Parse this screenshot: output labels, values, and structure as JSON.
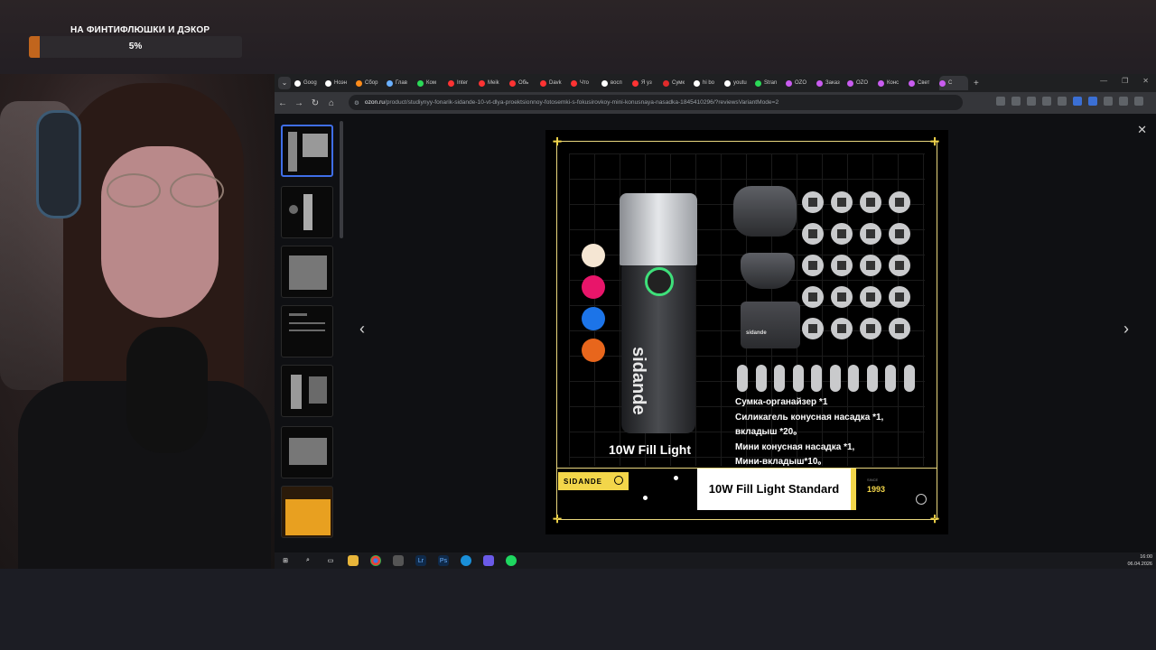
{
  "overlay": {
    "goal_title": "НА ФИНТИФЛЮШКИ И ДЭКОР",
    "goal_percent": "5%",
    "goal_progress": 0.05,
    "accent_color": "#c1651d"
  },
  "browser": {
    "tabs": [
      {
        "label": "Goog",
        "icon": "chrome-icon",
        "color": "#ffffff"
      },
      {
        "label": "Ноэн",
        "icon": "chrome-icon",
        "color": "#ffffff"
      },
      {
        "label": "Сбор",
        "icon": "d-icon",
        "color": "#ff8c1a"
      },
      {
        "label": "Глав",
        "icon": "di-icon",
        "color": "#6ab0ff"
      },
      {
        "label": "Ком",
        "icon": "k-icon",
        "color": "#2bd957"
      },
      {
        "label": "Inter",
        "icon": "youtube-icon",
        "color": "#ff3333"
      },
      {
        "label": "Meik",
        "icon": "youtube-icon",
        "color": "#ff3333"
      },
      {
        "label": "Обь",
        "icon": "k-icon",
        "color": "#ff3333"
      },
      {
        "label": "Davk",
        "icon": "youtube-icon",
        "color": "#ff3333"
      },
      {
        "label": "Что",
        "icon": "youtube-icon",
        "color": "#ff3333"
      },
      {
        "label": "восп",
        "icon": "chrome-icon",
        "color": "#ffffff"
      },
      {
        "label": "Я уз",
        "icon": "youtube-icon",
        "color": "#ff3333"
      },
      {
        "label": "Сумк",
        "icon": "m-icon",
        "color": "#e02b2b"
      },
      {
        "label": "hi bo",
        "icon": "chrome-icon",
        "color": "#ffffff"
      },
      {
        "label": "youtu",
        "icon": "chrome-icon",
        "color": "#ffffff"
      },
      {
        "label": "Stran",
        "icon": "k-icon",
        "color": "#2bd957"
      },
      {
        "label": "OZO",
        "icon": "ozon-icon",
        "color": "#c95cf0"
      },
      {
        "label": "Заказ",
        "icon": "ozon-icon",
        "color": "#c95cf0"
      },
      {
        "label": "OZO",
        "icon": "ozon-icon",
        "color": "#c95cf0"
      },
      {
        "label": "Конс",
        "icon": "ozon-icon",
        "color": "#c95cf0"
      },
      {
        "label": "Свет",
        "icon": "ozon-icon",
        "color": "#c95cf0"
      },
      {
        "label": "С",
        "icon": "ozon-icon",
        "color": "#c95cf0"
      }
    ],
    "url_host": "ozon.ru",
    "url_path": "/product/studiynyy-fonarik-sidande-10-vt-dlya-proektsionnoy-fotosemki-s-fokusirovkoy-mini-konusnaya-nasadka-1845410296/?reviewsVariantMode=2"
  },
  "product": {
    "brand_vertical": "sidande",
    "fill_label": "10W Fill Light",
    "swatches": [
      "#f5e6d3",
      "#e8156a",
      "#1c74e8",
      "#e8661c"
    ],
    "specs": [
      "Сумка-органайзер *1",
      "Силикагель конусная насадка *1,",
      "вкладыш *20。",
      "Мини конусная насадка *1,",
      "Мини-вкладыш*10。"
    ],
    "footer_brand": "SIDANDE",
    "standard_label": "10W Fill Light Standard",
    "since_label": "SINCE",
    "since_year": "1993",
    "accent": "#f3d64a",
    "bag_label": "sidande"
  },
  "taskbar": {
    "clock_time": "16:00",
    "clock_date": "06.04.2026"
  }
}
